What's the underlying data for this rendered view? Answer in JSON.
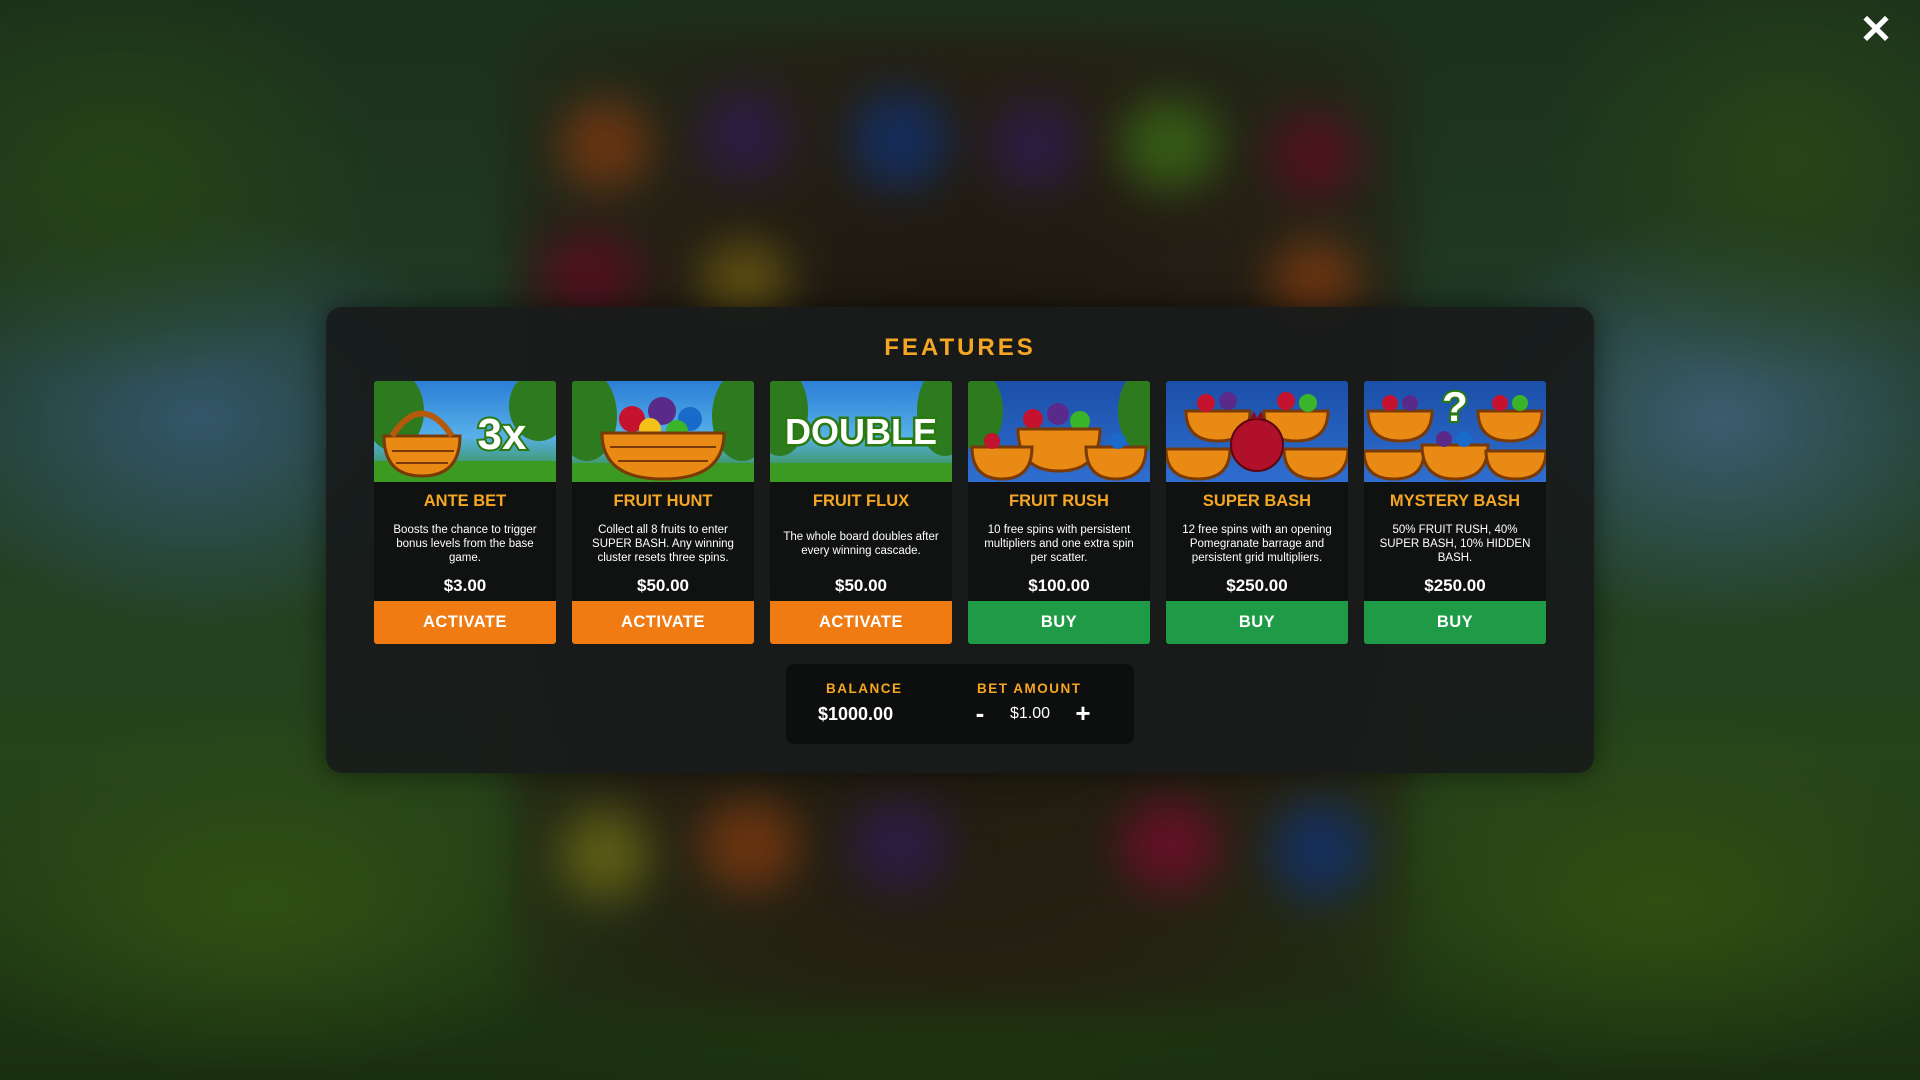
{
  "modal": {
    "title": "FEATURES",
    "close_icon": "close-icon"
  },
  "features": [
    {
      "name": "ANTE BET",
      "description": "Boosts the chance to trigger bonus levels from the base game.",
      "price": "$3.00",
      "button": "ACTIVATE",
      "art_text": "3x",
      "art_icon": "basket-icon"
    },
    {
      "name": "FRUIT HUNT",
      "description": "Collect all 8 fruits to enter SUPER BASH. Any winning cluster resets three spins.",
      "price": "$50.00",
      "button": "ACTIVATE",
      "art_icon": "fruit-basket-icon"
    },
    {
      "name": "FRUIT FLUX",
      "description": "The whole board doubles after every winning cascade.",
      "price": "$50.00",
      "button": "ACTIVATE",
      "art_text": "DOUBLE"
    },
    {
      "name": "FRUIT RUSH",
      "description": "10 free spins with persistent multipliers and one extra spin per scatter.",
      "price": "$100.00",
      "button": "BUY",
      "art_icon": "fruit-baskets-icon"
    },
    {
      "name": "SUPER BASH",
      "description": "12 free spins with an opening Pomegranate barrage and persistent grid multipliers.",
      "price": "$250.00",
      "button": "BUY",
      "art_icon": "pomegranate-icon"
    },
    {
      "name": "MYSTERY BASH",
      "description": "50% FRUIT RUSH, 40% SUPER BASH, 10% HIDDEN BASH.",
      "price": "$250.00",
      "button": "BUY",
      "art_text": "?"
    }
  ],
  "colors": {
    "accent": "#f5a623",
    "activate": "#f07b12",
    "buy": "#1f9a47",
    "panel": "#181b1b"
  },
  "wallet": {
    "balance_label": "BALANCE",
    "balance": "$1000.00",
    "bet_label": "BET AMOUNT",
    "bet_amount": "$1.00",
    "minus": "-",
    "plus": "+"
  }
}
